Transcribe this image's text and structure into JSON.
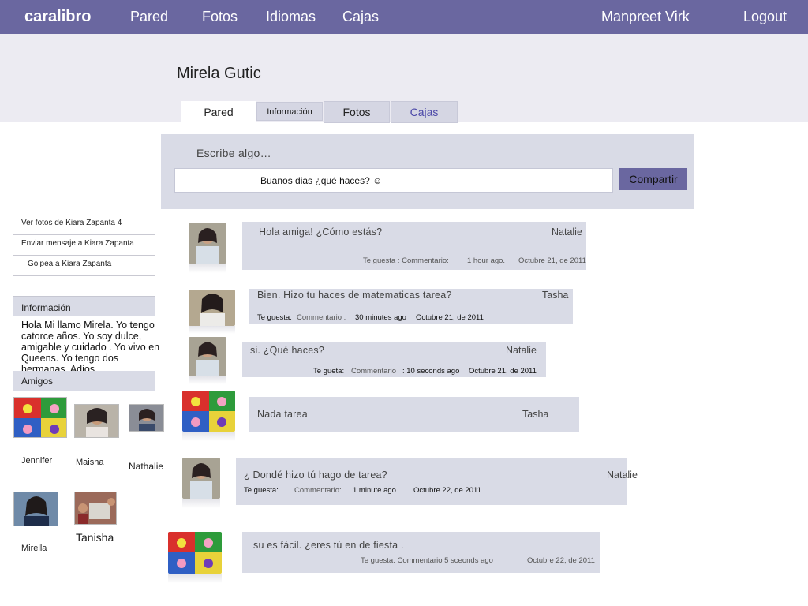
{
  "topbar": {
    "brand": "caralibro",
    "nav": [
      "Pared",
      "Fotos",
      "Idiomas",
      "Cajas"
    ],
    "user": "Manpreet Virk",
    "logout": "Logout"
  },
  "profile": {
    "name": "Mirela Gutic",
    "tabs": [
      "Pared",
      "Información",
      "Fotos",
      "Cajas"
    ]
  },
  "composer": {
    "label": "Escribe algo…",
    "value": "Buanos dias ¿qué haces? ☺",
    "share": "Compartir"
  },
  "sidebar": {
    "links": [
      "Ver fotos de Kiara Zapanta 4",
      "Enviar mensaje a Kiara Zapanta",
      "Golpea a Kiara Zapanta"
    ],
    "info_head": "Información",
    "about": "Hola Mi llamo Mirela. Yo tengo catorce años. Yo soy dulce, amigable y cuidado . Yo vivo en Queens. Yo tengo dos hermanas. Adios",
    "friends_head": "Amigos",
    "friends": [
      "Jennifer",
      "Maisha",
      "Nathalie",
      "Mirella",
      "Tanisha"
    ]
  },
  "posts": [
    {
      "message": "Hola amiga!  ¿Cómo estás?",
      "author": "Natalie",
      "like": "Te guesta : Commentario:",
      "time": "1 hour ago.",
      "date": "Octubre 21, de 2011"
    },
    {
      "message": "Bien.  Hizo tu haces  de matematicas tarea?",
      "author": "Tasha",
      "like": "Te guesta:",
      "comment": "Commentario :",
      "time": "30 minutes ago",
      "date": "Octubre 21, de 2011"
    },
    {
      "message": "si. ¿Qué haces?",
      "author": "Natalie",
      "like": "Te gueta:",
      "comment": "Commentario",
      "time": ": 10 seconds ago",
      "date": "Octubre 21,  de 2011"
    },
    {
      "message": "Nada tarea",
      "author": "Tasha"
    },
    {
      "message": "¿ Dondé  hizo tú  hago de  tarea?",
      "author": "Natalie",
      "like": "Te guesta:",
      "comment": "Commentario:",
      "time": "1 minute ago",
      "date": "Octubre 22, de 2011"
    },
    {
      "message": "su es fácil.  ¿eres tú en de fiesta .",
      "like": "Te guesta: Commentario 5 sceonds ago",
      "date": "Octubre 22, de 2011"
    }
  ],
  "colors": {
    "accent": "#6a67a0",
    "panel": "#d9dbe6",
    "banner": "#ecebf2"
  }
}
